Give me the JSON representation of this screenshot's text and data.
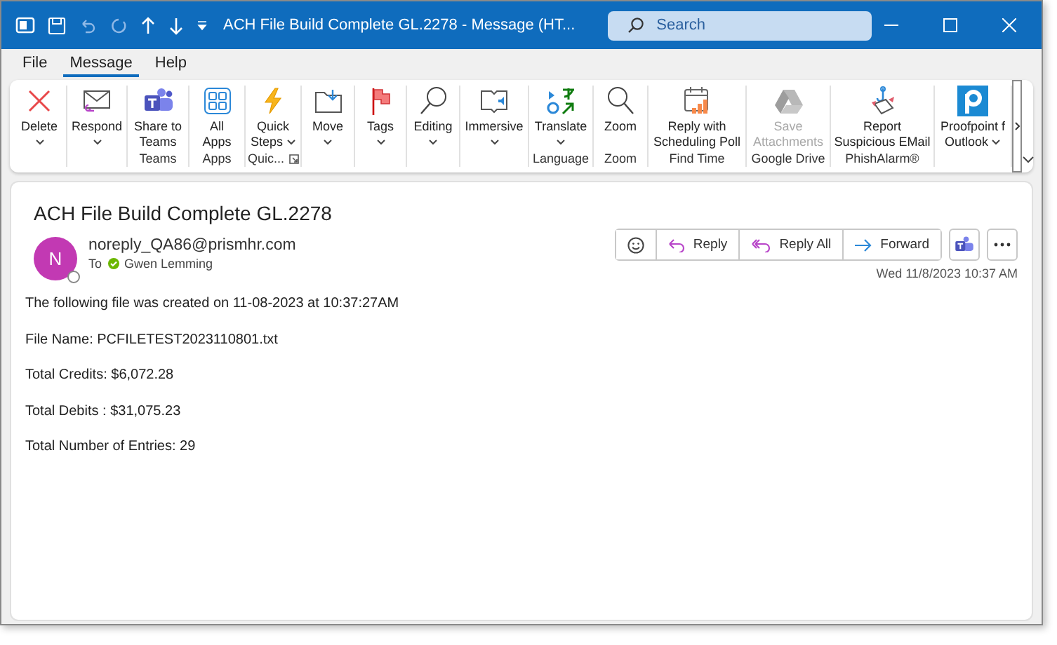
{
  "window": {
    "title": "ACH File Build Complete GL.2278  -  Message (HT...",
    "search_placeholder": "Search"
  },
  "menu_tabs": [
    {
      "label": "File",
      "selected": false
    },
    {
      "label": "Message",
      "selected": true
    },
    {
      "label": "Help",
      "selected": false
    }
  ],
  "ribbon": {
    "groups": [
      {
        "buttons": [
          {
            "lines": [
              "Delete"
            ],
            "dropdown": true,
            "disabled": false
          }
        ]
      },
      {
        "buttons": [
          {
            "lines": [
              "Respond"
            ],
            "dropdown": true,
            "disabled": false
          }
        ]
      },
      {
        "label": "Teams",
        "buttons": [
          {
            "lines": [
              "Share to",
              "Teams"
            ],
            "disabled": false
          }
        ]
      },
      {
        "label": "Apps",
        "buttons": [
          {
            "lines": [
              "All",
              "Apps"
            ],
            "disabled": false
          }
        ]
      },
      {
        "label": "Quic...",
        "launcher": true,
        "buttons": [
          {
            "lines": [
              "Quick",
              "Steps"
            ],
            "dropdown": true,
            "disabled": false
          }
        ]
      },
      {
        "buttons": [
          {
            "lines": [
              "Move"
            ],
            "dropdown": true,
            "disabled": false
          }
        ]
      },
      {
        "buttons": [
          {
            "lines": [
              "Tags"
            ],
            "dropdown": true,
            "disabled": false
          }
        ]
      },
      {
        "buttons": [
          {
            "lines": [
              "Editing"
            ],
            "dropdown": true,
            "disabled": false
          }
        ]
      },
      {
        "buttons": [
          {
            "lines": [
              "Immersive"
            ],
            "dropdown": true,
            "disabled": false
          }
        ]
      },
      {
        "label": "Language",
        "buttons": [
          {
            "lines": [
              "Translate"
            ],
            "dropdown": true,
            "disabled": false
          }
        ]
      },
      {
        "label": "Zoom",
        "buttons": [
          {
            "lines": [
              "Zoom"
            ],
            "disabled": false
          }
        ]
      },
      {
        "label": "Find Time",
        "buttons": [
          {
            "lines": [
              "Reply with",
              "Scheduling Poll"
            ],
            "disabled": false
          }
        ]
      },
      {
        "label": "Google Drive",
        "buttons": [
          {
            "lines": [
              "Save",
              "Attachments"
            ],
            "disabled": true
          }
        ]
      },
      {
        "label": "PhishAlarm®",
        "buttons": [
          {
            "lines": [
              "Report",
              "Suspicious EMail"
            ],
            "disabled": false
          }
        ]
      },
      {
        "buttons": [
          {
            "lines": [
              "Proofpoint f",
              "Outlook"
            ],
            "dropdown": true,
            "disabled": false
          }
        ]
      }
    ]
  },
  "message": {
    "subject": "ACH File Build Complete GL.2278",
    "avatar_initial": "N",
    "sender": "noreply_QA86@prismhr.com",
    "to_label": "To",
    "recipient": "Gwen Lemming",
    "actions": [
      {
        "kind": "emoji"
      },
      {
        "kind": "reply",
        "label": "Reply"
      },
      {
        "kind": "reply-all",
        "label": "Reply All"
      },
      {
        "kind": "forward",
        "label": "Forward"
      }
    ],
    "date": "Wed 11/8/2023 10:37 AM",
    "body": [
      "The following file was created on 11-08-2023 at 10:37:27AM",
      "File Name: PCFILETEST2023110801.txt",
      "Total Credits: $6,072.28",
      "Total Debits : $31,075.23",
      "Total Number of Entries: 29"
    ]
  }
}
